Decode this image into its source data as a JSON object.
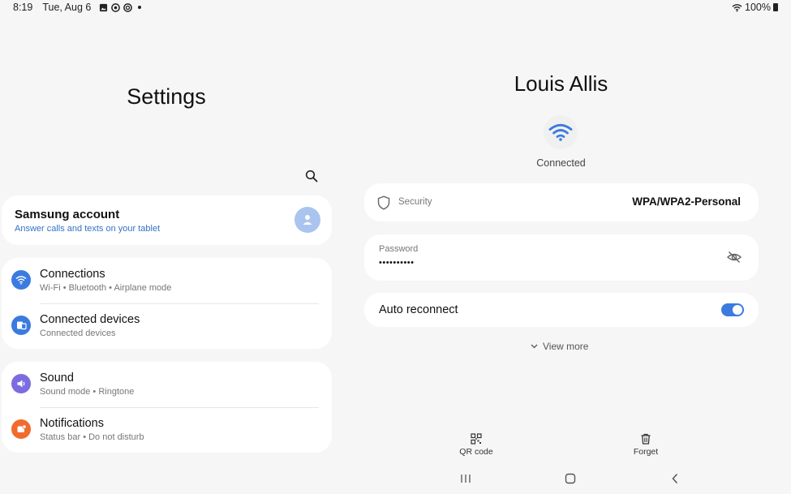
{
  "status_bar": {
    "time": "8:19",
    "date": "Tue, Aug 6",
    "battery": "100%"
  },
  "left": {
    "title": "Settings",
    "account": {
      "title": "Samsung account",
      "subtitle": "Answer calls and texts on your tablet"
    },
    "groups": [
      [
        {
          "title": "Connections",
          "subtitle": "Wi-Fi  •  Bluetooth  •  Airplane mode",
          "color": "#3b7be0",
          "icon": "wifi-icon"
        },
        {
          "title": "Connected devices",
          "subtitle": "Connected devices",
          "color": "#3b7be0",
          "icon": "devices-icon"
        }
      ],
      [
        {
          "title": "Sound",
          "subtitle": "Sound mode  •  Ringtone",
          "color": "#7b6ce0",
          "icon": "speaker-icon"
        },
        {
          "title": "Notifications",
          "subtitle": "Status bar  •  Do not disturb",
          "color": "#f26b2e",
          "icon": "bell-icon"
        }
      ]
    ]
  },
  "right": {
    "network_name": "Louis Allis",
    "status": "Connected",
    "security": {
      "label": "Security",
      "value": "WPA/WPA2-Personal"
    },
    "password": {
      "label": "Password",
      "value": "••••••••••"
    },
    "auto_reconnect": {
      "label": "Auto reconnect",
      "on": true
    },
    "view_more": "View more",
    "actions": {
      "qr": "QR code",
      "forget": "Forget"
    }
  },
  "colors": {
    "accent": "#3b7be0",
    "link": "#3273c9",
    "background": "#f6f6f6"
  }
}
